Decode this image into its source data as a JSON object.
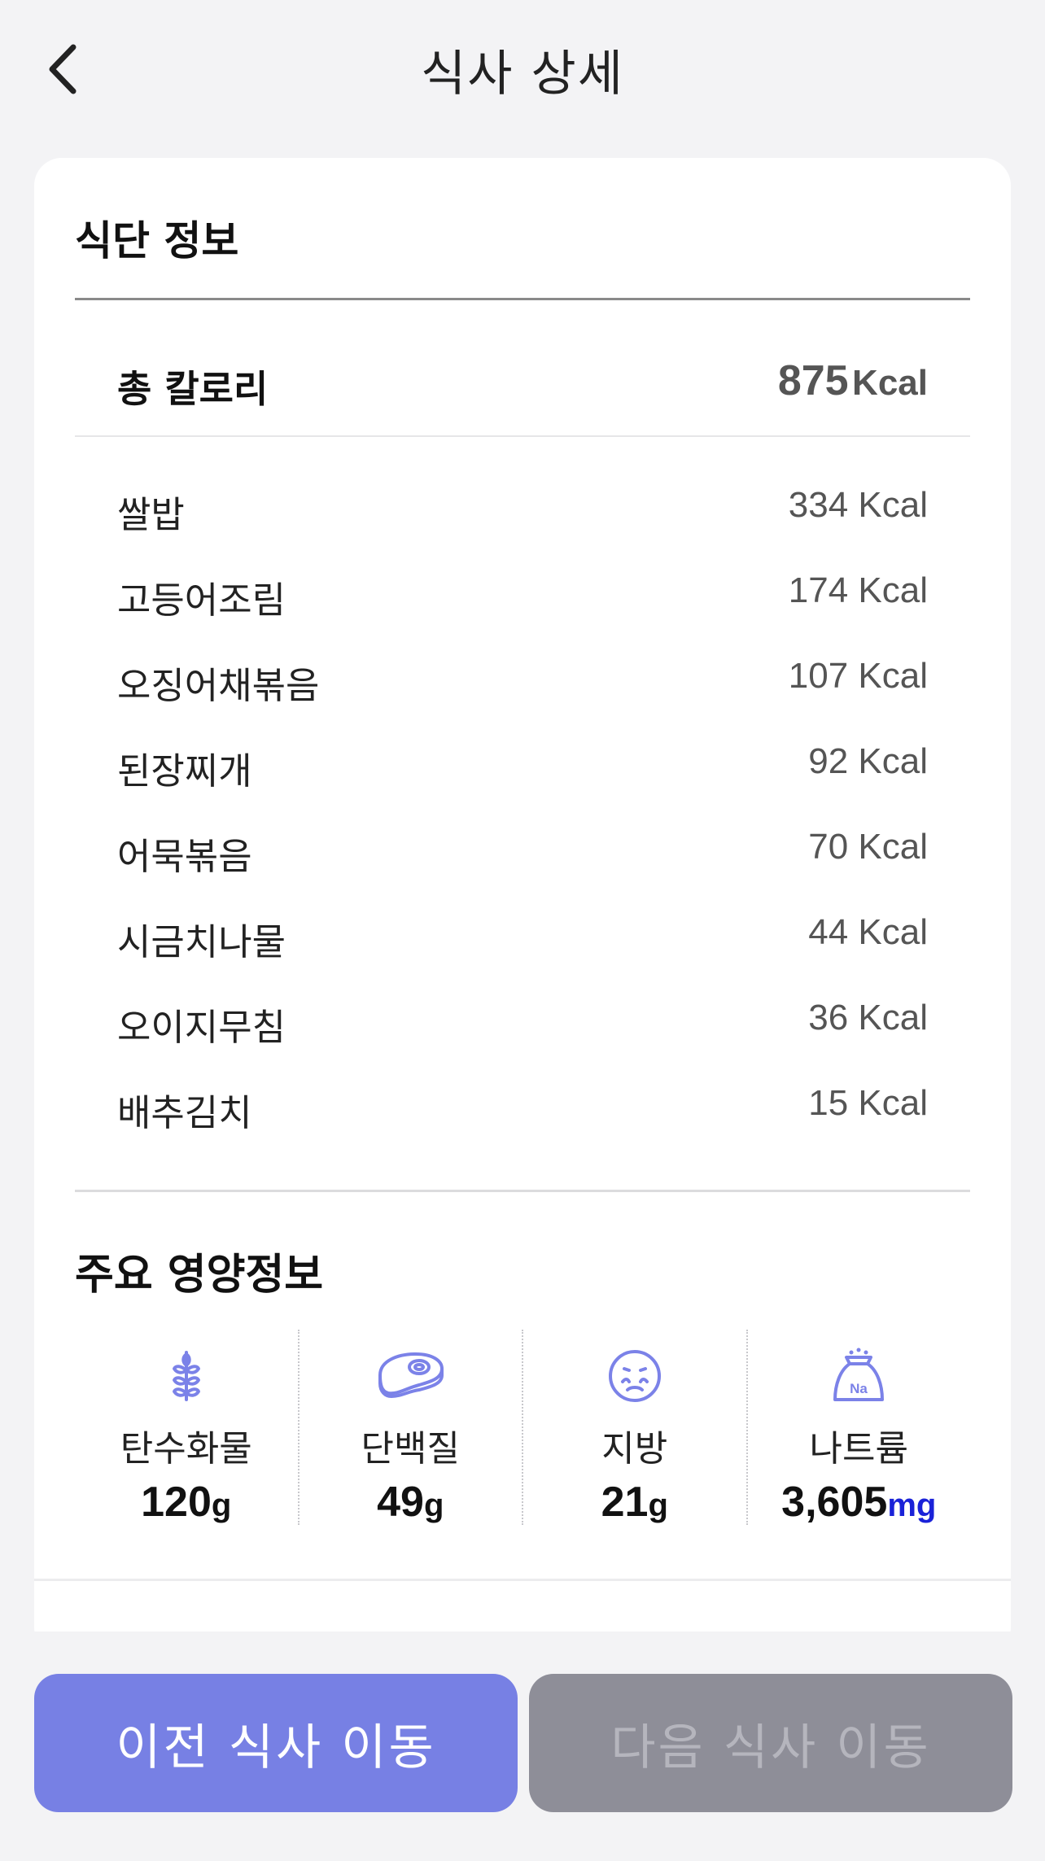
{
  "header": {
    "title": "식사 상세",
    "back_icon": "chevron-left-icon"
  },
  "diet_info": {
    "section_title": "식단 정보",
    "total": {
      "label": "총 칼로리",
      "value": "875",
      "unit": "Kcal"
    },
    "items": [
      {
        "name": "쌀밥",
        "kcal": "334 Kcal"
      },
      {
        "name": "고등어조림",
        "kcal": "174 Kcal"
      },
      {
        "name": "오징어채볶음",
        "kcal": "107 Kcal"
      },
      {
        "name": "된장찌개",
        "kcal": "92 Kcal"
      },
      {
        "name": "어묵볶음",
        "kcal": "70 Kcal"
      },
      {
        "name": "시금치나물",
        "kcal": "44 Kcal"
      },
      {
        "name": "오이지무침",
        "kcal": "36 Kcal"
      },
      {
        "name": "배추김치",
        "kcal": "15 Kcal"
      }
    ]
  },
  "nutrition": {
    "section_title": "주요 영양정보",
    "items": [
      {
        "label": "탄수화물",
        "value": "120",
        "unit": "g",
        "icon": "wheat-icon"
      },
      {
        "label": "단백질",
        "value": "49",
        "unit": "g",
        "icon": "meat-icon"
      },
      {
        "label": "지방",
        "value": "21",
        "unit": "g",
        "icon": "fat-face-icon"
      },
      {
        "label": "나트륨",
        "value": "3,605",
        "unit": "mg",
        "icon": "salt-bag-icon",
        "icon_text": "Na"
      }
    ]
  },
  "buttons": {
    "prev": "이전 식사 이동",
    "next": "다음 식사 이동"
  },
  "colors": {
    "accent": "#7780e4",
    "icon": "#7b82e8",
    "disabled": "#8e8e98",
    "sodium_unit": "#1a22d8"
  }
}
